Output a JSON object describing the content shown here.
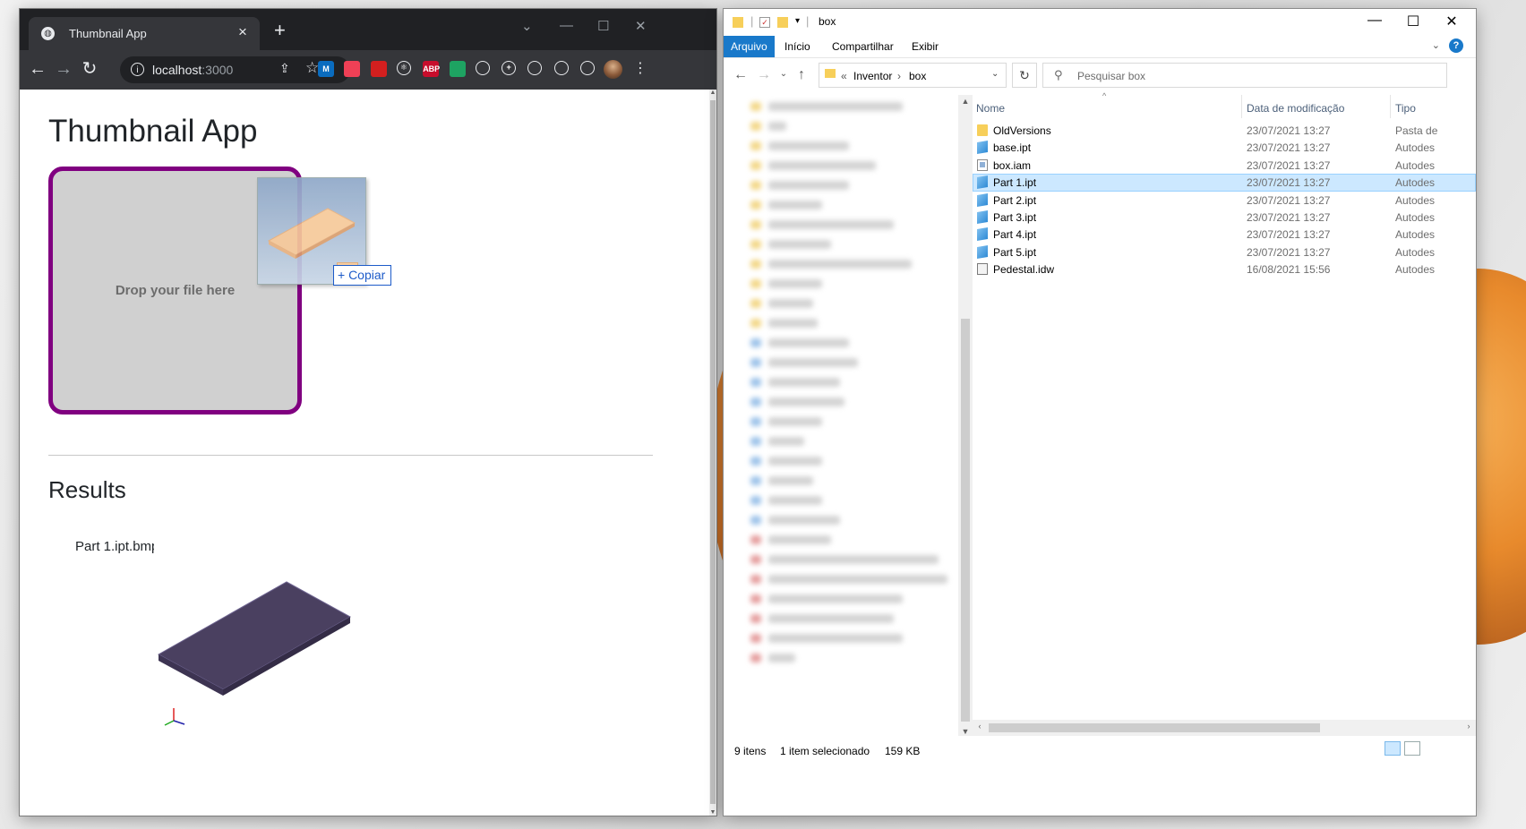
{
  "browser": {
    "tab_title": "Thumbnail App",
    "tab_close_glyph": "×",
    "new_tab_glyph": "+",
    "url_host": "localhost",
    "url_port": ":3000",
    "extensions": [
      {
        "name": "m-extension-icon",
        "label": "M",
        "color": "#0a6cbf"
      },
      {
        "name": "pocket-icon",
        "label": "",
        "color": "#ef4056"
      },
      {
        "name": "acrobat-icon",
        "label": "",
        "color": "#d31f1f"
      },
      {
        "name": "react-devtools-icon",
        "label": "⚛",
        "color": "#35363a"
      },
      {
        "name": "adblock-plus-icon",
        "label": "ABP",
        "color": "#c70d2c"
      },
      {
        "name": "green-shield-icon",
        "label": "",
        "color": "#1ea362"
      },
      {
        "name": "diamond-icon",
        "label": "",
        "color": "#35363a"
      },
      {
        "name": "plus-circle-icon",
        "label": "+",
        "color": "#35363a"
      },
      {
        "name": "circle-extension-icon",
        "label": "",
        "color": "#35363a"
      },
      {
        "name": "puzzle-icon",
        "label": "",
        "color": "#35363a"
      },
      {
        "name": "reading-list-icon",
        "label": "",
        "color": "#35363a"
      }
    ]
  },
  "app": {
    "title": "Thumbnail App",
    "dropzone_text": "Drop your file here",
    "drag_copy_label": "+ Copiar",
    "results_heading": "Results",
    "result_filename": "Part 1.ipt.bmp"
  },
  "explorer": {
    "title": "box",
    "ribbon_tabs": [
      "Arquivo",
      "Início",
      "Compartilhar",
      "Exibir"
    ],
    "breadcrumb_prefix": "«",
    "breadcrumb": [
      "Inventor",
      "box"
    ],
    "search_placeholder": "Pesquisar box",
    "columns": {
      "name": "Nome",
      "date": "Data de modificação",
      "type": "Tipo"
    },
    "files": [
      {
        "name": "OldVersions",
        "date": "23/07/2021 13:27",
        "type": "Pasta de",
        "icon": "folder",
        "selected": false
      },
      {
        "name": "base.ipt",
        "date": "23/07/2021 13:27",
        "type": "Autodes",
        "icon": "part",
        "selected": false
      },
      {
        "name": "box.iam",
        "date": "23/07/2021 13:27",
        "type": "Autodes",
        "icon": "asm",
        "selected": false
      },
      {
        "name": "Part 1.ipt",
        "date": "23/07/2021 13:27",
        "type": "Autodes",
        "icon": "part",
        "selected": true
      },
      {
        "name": "Part 2.ipt",
        "date": "23/07/2021 13:27",
        "type": "Autodes",
        "icon": "part",
        "selected": false
      },
      {
        "name": "Part 3.ipt",
        "date": "23/07/2021 13:27",
        "type": "Autodes",
        "icon": "part",
        "selected": false
      },
      {
        "name": "Part 4.ipt",
        "date": "23/07/2021 13:27",
        "type": "Autodes",
        "icon": "part",
        "selected": false
      },
      {
        "name": "Part 5.ipt",
        "date": "23/07/2021 13:27",
        "type": "Autodes",
        "icon": "part",
        "selected": false
      },
      {
        "name": "Pedestal.idw",
        "date": "16/08/2021 15:56",
        "type": "Autodes",
        "icon": "drw",
        "selected": false
      }
    ],
    "status_count": "9 itens",
    "status_selection": "1 item selecionado",
    "status_size": "159 KB"
  },
  "colors": {
    "dropzone_border": "#800080",
    "dropzone_bg": "#d0d0d0",
    "explorer_accent": "#1979ca",
    "selection": "#cce8ff"
  }
}
